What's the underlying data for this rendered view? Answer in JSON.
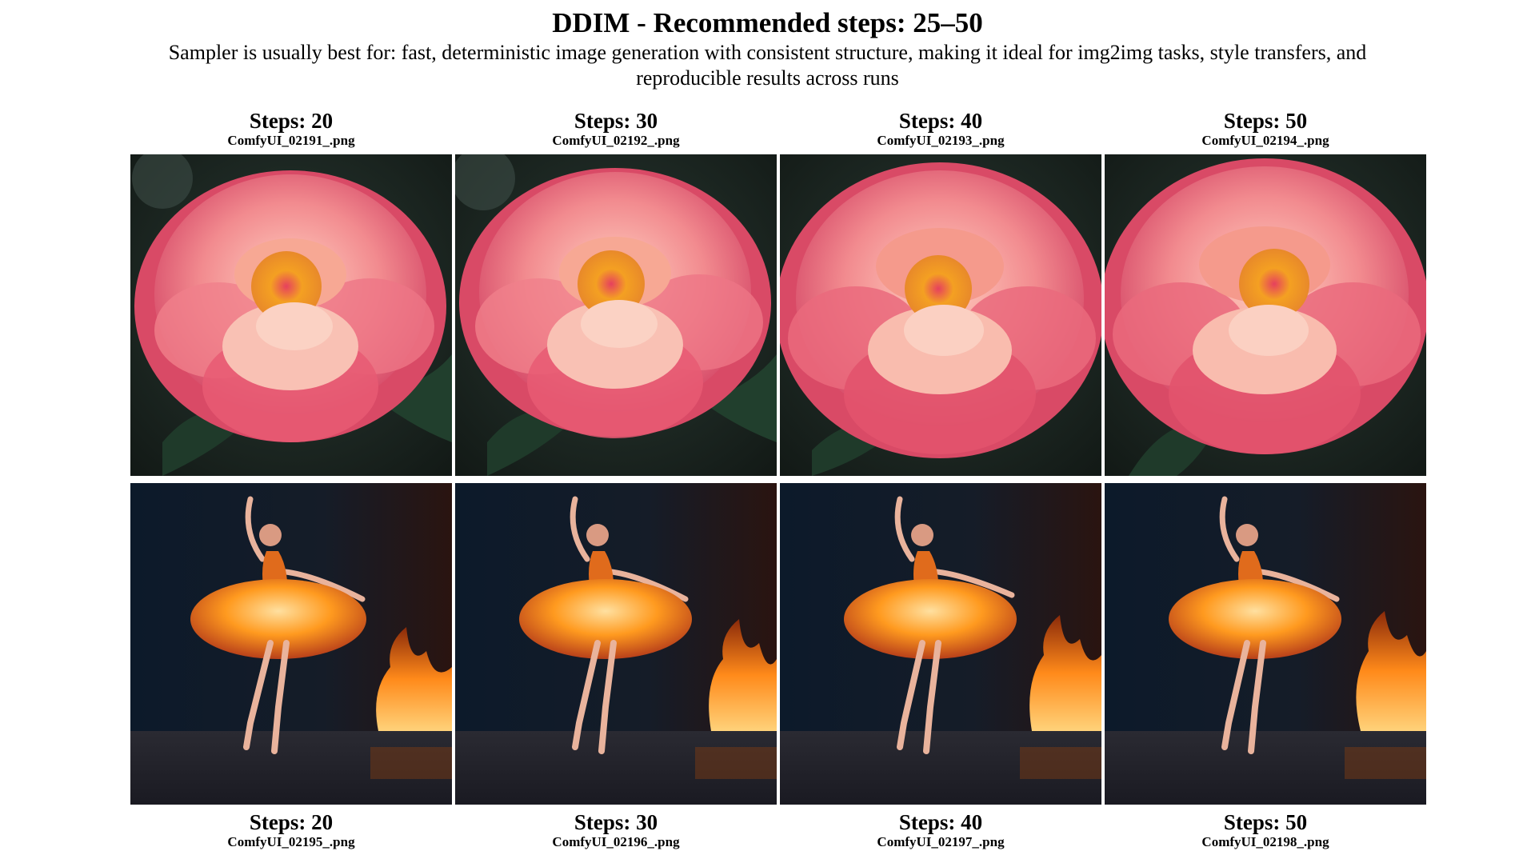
{
  "title": "DDIM - Recommended steps: 25–50",
  "subtitle": "Sampler is usually best for: fast, deterministic image generation with consistent structure, making it ideal for img2img tasks, style transfers, and reproducible results across runs",
  "rows": [
    {
      "subject": "peony-flower",
      "cells": [
        {
          "steps": "Steps: 20",
          "filename": "ComfyUI_02191_.png"
        },
        {
          "steps": "Steps: 30",
          "filename": "ComfyUI_02192_.png"
        },
        {
          "steps": "Steps: 40",
          "filename": "ComfyUI_02193_.png"
        },
        {
          "steps": "Steps: 50",
          "filename": "ComfyUI_02194_.png"
        }
      ]
    },
    {
      "subject": "fire-ballerina",
      "cells": [
        {
          "steps": "Steps: 20",
          "filename": "ComfyUI_02195_.png"
        },
        {
          "steps": "Steps: 30",
          "filename": "ComfyUI_02196_.png"
        },
        {
          "steps": "Steps: 40",
          "filename": "ComfyUI_02197_.png"
        },
        {
          "steps": "Steps: 50",
          "filename": "ComfyUI_02198_.png"
        }
      ]
    }
  ],
  "colors": {
    "petal_light": "#f8b3a6",
    "petal_mid": "#ee7d86",
    "petal_deep": "#d94a66",
    "flower_center": "#f2a01f",
    "flower_bg": "#1b2420",
    "stage_bg": "#0d1622",
    "fire": "#ff9a1f",
    "fire_core": "#ffd27a",
    "skin": "#e9b39c"
  }
}
